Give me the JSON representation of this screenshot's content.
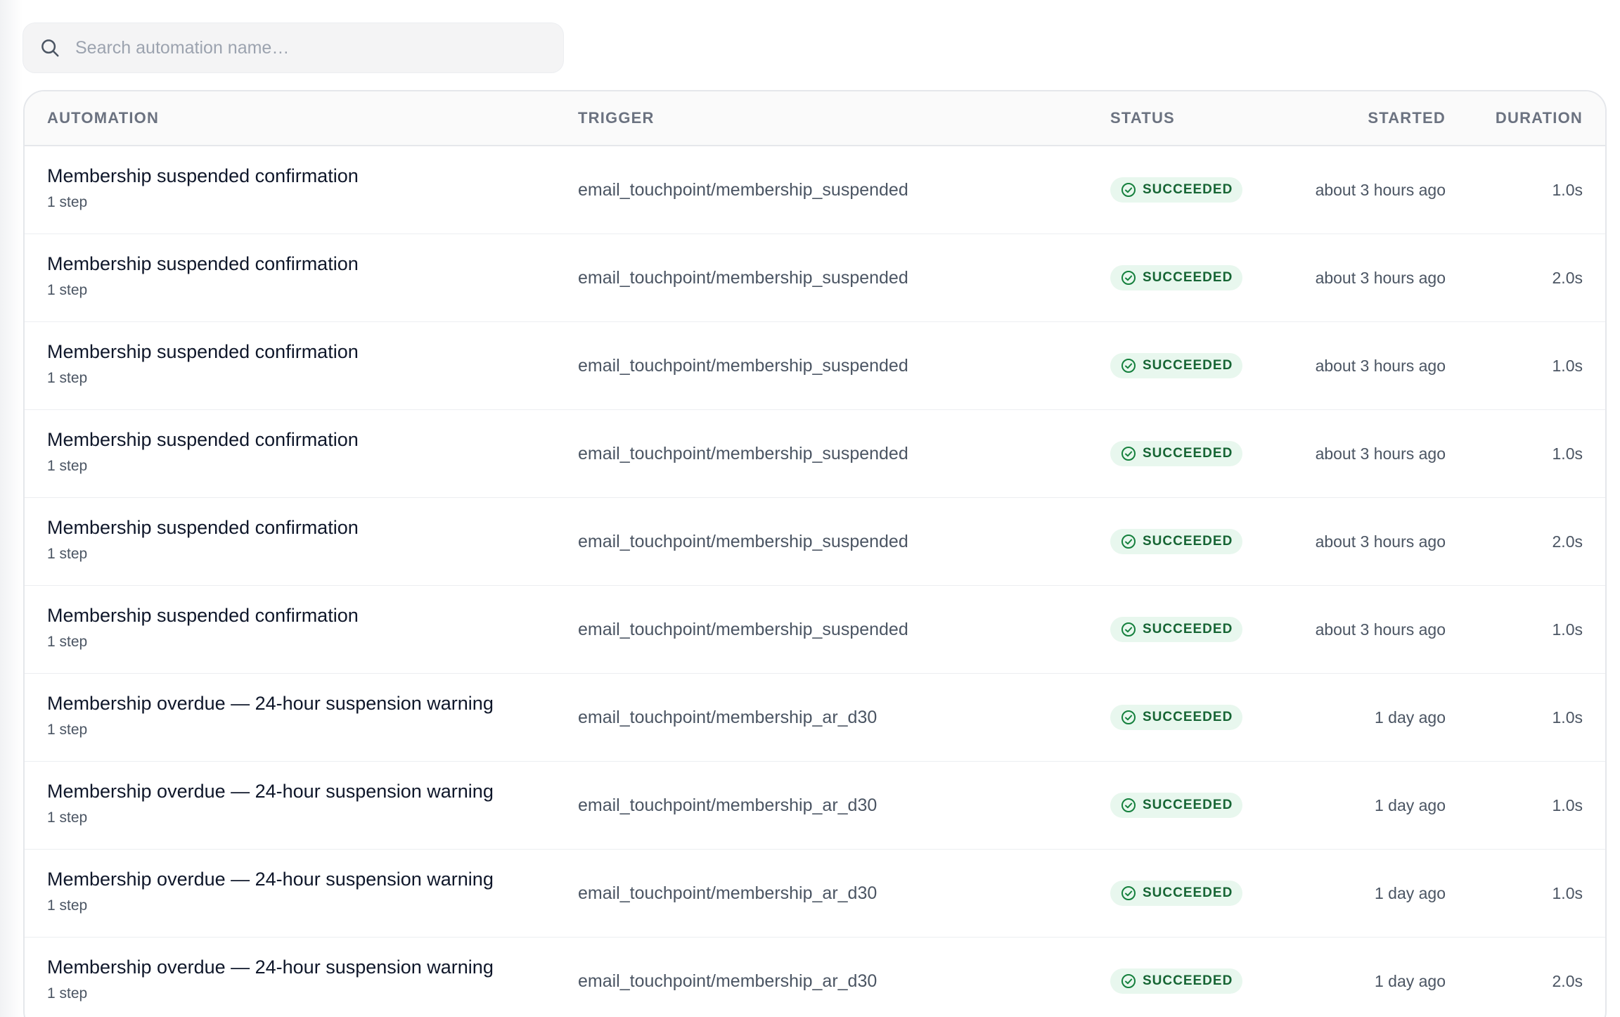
{
  "search": {
    "placeholder": "Search automation name…",
    "value": "",
    "icon": "search-icon"
  },
  "table": {
    "columns": {
      "automation": "AUTOMATION",
      "trigger": "TRIGGER",
      "status": "STATUS",
      "started": "STARTED",
      "duration": "DURATION"
    },
    "status_icon": "check-circle-icon",
    "colors": {
      "success_bg": "#e8f7ee",
      "success_text": "#166534"
    },
    "rows": [
      {
        "name": "Membership suspended confirmation",
        "steps": "1 step",
        "trigger": "email_touchpoint/membership_suspended",
        "status": "SUCCEEDED",
        "started": "about 3 hours ago",
        "duration": "1.0s"
      },
      {
        "name": "Membership suspended confirmation",
        "steps": "1 step",
        "trigger": "email_touchpoint/membership_suspended",
        "status": "SUCCEEDED",
        "started": "about 3 hours ago",
        "duration": "2.0s"
      },
      {
        "name": "Membership suspended confirmation",
        "steps": "1 step",
        "trigger": "email_touchpoint/membership_suspended",
        "status": "SUCCEEDED",
        "started": "about 3 hours ago",
        "duration": "1.0s"
      },
      {
        "name": "Membership suspended confirmation",
        "steps": "1 step",
        "trigger": "email_touchpoint/membership_suspended",
        "status": "SUCCEEDED",
        "started": "about 3 hours ago",
        "duration": "1.0s"
      },
      {
        "name": "Membership suspended confirmation",
        "steps": "1 step",
        "trigger": "email_touchpoint/membership_suspended",
        "status": "SUCCEEDED",
        "started": "about 3 hours ago",
        "duration": "2.0s"
      },
      {
        "name": "Membership suspended confirmation",
        "steps": "1 step",
        "trigger": "email_touchpoint/membership_suspended",
        "status": "SUCCEEDED",
        "started": "about 3 hours ago",
        "duration": "1.0s"
      },
      {
        "name": "Membership overdue — 24-hour suspension warning",
        "steps": "1 step",
        "trigger": "email_touchpoint/membership_ar_d30",
        "status": "SUCCEEDED",
        "started": "1 day ago",
        "duration": "1.0s"
      },
      {
        "name": "Membership overdue — 24-hour suspension warning",
        "steps": "1 step",
        "trigger": "email_touchpoint/membership_ar_d30",
        "status": "SUCCEEDED",
        "started": "1 day ago",
        "duration": "1.0s"
      },
      {
        "name": "Membership overdue — 24-hour suspension warning",
        "steps": "1 step",
        "trigger": "email_touchpoint/membership_ar_d30",
        "status": "SUCCEEDED",
        "started": "1 day ago",
        "duration": "1.0s"
      },
      {
        "name": "Membership overdue — 24-hour suspension warning",
        "steps": "1 step",
        "trigger": "email_touchpoint/membership_ar_d30",
        "status": "SUCCEEDED",
        "started": "1 day ago",
        "duration": "2.0s"
      }
    ]
  }
}
